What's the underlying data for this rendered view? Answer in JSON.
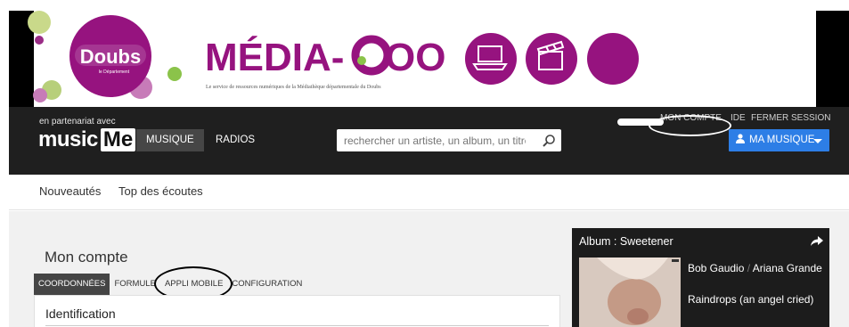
{
  "banner": {
    "doubs_text": "Doubs",
    "doubs_sub": "le Département",
    "media_doo_left": "MÉDIA-",
    "media_doo_right": "OO",
    "tagline": "Le service de ressources numériques de la Médiathèque départementale du Doubs"
  },
  "header": {
    "partner": "en partenariat avec",
    "logo_part1": "music",
    "logo_part2": "Me",
    "nav": [
      {
        "label": "MUSIQUE"
      },
      {
        "label": "RADIOS"
      }
    ],
    "search_placeholder": "rechercher un artiste, un album, un titre...",
    "top_links": {
      "account": "MON COMPTE",
      "help_partial": "IDE",
      "logout": "FERMER SESSION"
    },
    "my_music": "MA MUSIQUE"
  },
  "subnav": [
    "Nouveautés",
    "Top des écoutes"
  ],
  "content": {
    "title": "Mon compte",
    "tabs": [
      {
        "label": "COORDONNÉES"
      },
      {
        "label": "FORMULE"
      },
      {
        "label": "APPLI MOBILE"
      },
      {
        "label": "CONFIGURATION"
      }
    ],
    "section_heading": "Identification"
  },
  "album": {
    "header": "Album :  Sweetener",
    "artist1": "Bob Gaudio",
    "separator": "/",
    "artist2": "Ariana Grande",
    "track": "Raindrops (an angel cried)"
  },
  "colors": {
    "brand_purple": "#96137f",
    "light_purple": "#c77bb8",
    "green": "#8bc34a",
    "header_bg": "#1f1f1f",
    "accent_blue": "#2d7ee6"
  }
}
